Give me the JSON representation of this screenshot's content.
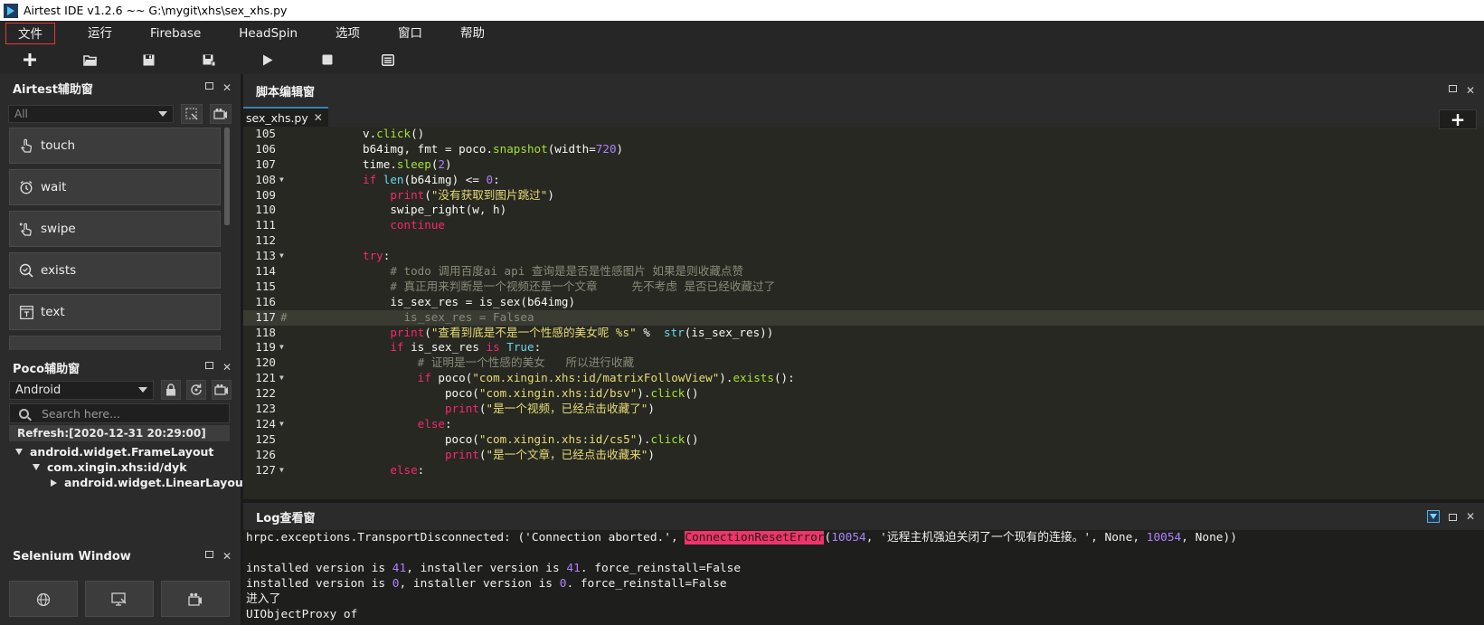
{
  "window": {
    "title": "Airtest IDE v1.2.6 ~~ G:\\mygit\\xhs\\sex_xhs.py"
  },
  "menu": [
    "文件",
    "运行",
    "Firebase",
    "HeadSpin",
    "选项",
    "窗口",
    "帮助"
  ],
  "toolbar": [
    "new-icon",
    "open-icon",
    "save-icon",
    "save-as-icon",
    "run-icon",
    "stop-icon",
    "log-icon"
  ],
  "airtest_panel": {
    "title": "Airtest辅助窗",
    "filter_placeholder": "All",
    "items": [
      {
        "label": "touch",
        "icon": "touch-icon"
      },
      {
        "label": "wait",
        "icon": "alarm-icon"
      },
      {
        "label": "swipe",
        "icon": "swipe-icon"
      },
      {
        "label": "exists",
        "icon": "search-icon"
      },
      {
        "label": "text",
        "icon": "text-icon"
      }
    ]
  },
  "poco_panel": {
    "title": "Poco辅助窗",
    "platform": "Android",
    "search_placeholder": "Search here...",
    "refresh": "Refresh:[2020-12-31 20:29:00]",
    "tree": [
      {
        "label": "android.widget.FrameLayout",
        "depth": 0,
        "expanded": true
      },
      {
        "label": "com.xingin.xhs:id/dyk",
        "depth": 1,
        "expanded": true
      },
      {
        "label": "android.widget.LinearLayout",
        "depth": 2,
        "expanded": false
      }
    ]
  },
  "selenium_panel": {
    "title": "Selenium Window"
  },
  "editor": {
    "title": "脚本编辑窗",
    "tab": "sex_xhs.py",
    "highlighted_line": 117,
    "lines": [
      {
        "n": "105",
        "fold": false,
        "code": [
          [
            "",
            "            v."
          ],
          [
            "fn",
            "click"
          ],
          [
            "",
            "()"
          ]
        ]
      },
      {
        "n": "106",
        "fold": false,
        "code": [
          [
            "",
            "            b64img, fmt = poco."
          ],
          [
            "fn",
            "snapshot"
          ],
          [
            "",
            "(width="
          ],
          [
            "num",
            "720"
          ],
          [
            "",
            ")"
          ]
        ]
      },
      {
        "n": "107",
        "fold": false,
        "code": [
          [
            "",
            "            time."
          ],
          [
            "fn",
            "sleep"
          ],
          [
            "",
            "("
          ],
          [
            "num",
            "2"
          ],
          [
            "",
            ")"
          ]
        ]
      },
      {
        "n": "108",
        "fold": true,
        "code": [
          [
            "",
            "            "
          ],
          [
            "kw",
            "if"
          ],
          [
            "",
            " "
          ],
          [
            "bi",
            "len"
          ],
          [
            "",
            "(b64img) <= "
          ],
          [
            "num",
            "0"
          ],
          [
            "",
            ":"
          ]
        ]
      },
      {
        "n": "109",
        "fold": false,
        "code": [
          [
            "",
            "                "
          ],
          [
            "kw",
            "print"
          ],
          [
            "",
            "("
          ],
          [
            "str",
            "\"没有获取到图片跳过\""
          ],
          [
            "",
            ")"
          ]
        ]
      },
      {
        "n": "110",
        "fold": false,
        "code": [
          [
            "",
            "                swipe_right(w, h)"
          ]
        ]
      },
      {
        "n": "111",
        "fold": false,
        "code": [
          [
            "",
            "                "
          ],
          [
            "kw",
            "continue"
          ]
        ]
      },
      {
        "n": "112",
        "fold": false,
        "code": [
          [
            "",
            ""
          ]
        ]
      },
      {
        "n": "113",
        "fold": true,
        "code": [
          [
            "",
            "            "
          ],
          [
            "kw",
            "try"
          ],
          [
            "",
            ":"
          ]
        ]
      },
      {
        "n": "114",
        "fold": false,
        "code": [
          [
            "",
            "                "
          ],
          [
            "cm",
            "# todo 调用百度ai api 查询是是否是性感图片 如果是则收藏点赞"
          ]
        ]
      },
      {
        "n": "115",
        "fold": false,
        "code": [
          [
            "",
            "                "
          ],
          [
            "cm",
            "# 真正用来判断是一个视频还是一个文章     先不考虑 是否已经收藏过了"
          ]
        ]
      },
      {
        "n": "116",
        "fold": false,
        "code": [
          [
            "",
            "                is_sex_res = is_sex(b64img)"
          ]
        ]
      },
      {
        "n": "117",
        "fold": false,
        "code": [
          [
            "cm",
            "#                 is_sex_res = Falsea"
          ]
        ]
      },
      {
        "n": "118",
        "fold": false,
        "code": [
          [
            "",
            "                "
          ],
          [
            "kw",
            "print"
          ],
          [
            "",
            "("
          ],
          [
            "str",
            "\"查看到底是不是一个性感的美女呢 %s\""
          ],
          [
            "",
            " %  "
          ],
          [
            "bi",
            "str"
          ],
          [
            "",
            "(is_sex_res))"
          ]
        ]
      },
      {
        "n": "119",
        "fold": true,
        "code": [
          [
            "",
            "                "
          ],
          [
            "kw",
            "if"
          ],
          [
            "",
            " is_sex_res "
          ],
          [
            "kw",
            "is"
          ],
          [
            "",
            " "
          ],
          [
            "bi",
            "True"
          ],
          [
            "",
            ":"
          ]
        ]
      },
      {
        "n": "120",
        "fold": false,
        "code": [
          [
            "",
            "                    "
          ],
          [
            "cm",
            "# 证明是一个性感的美女   所以进行收藏"
          ]
        ]
      },
      {
        "n": "121",
        "fold": true,
        "code": [
          [
            "",
            "                    "
          ],
          [
            "kw",
            "if"
          ],
          [
            "",
            " poco("
          ],
          [
            "str",
            "\"com.xingin.xhs:id/matrixFollowView\""
          ],
          [
            "",
            ")."
          ],
          [
            "fn",
            "exists"
          ],
          [
            "",
            "():"
          ]
        ]
      },
      {
        "n": "122",
        "fold": false,
        "code": [
          [
            "",
            "                        poco("
          ],
          [
            "str",
            "\"com.xingin.xhs:id/bsv\""
          ],
          [
            "",
            ")."
          ],
          [
            "fn",
            "click"
          ],
          [
            "",
            "()"
          ]
        ]
      },
      {
        "n": "123",
        "fold": false,
        "code": [
          [
            "",
            "                        "
          ],
          [
            "kw",
            "print"
          ],
          [
            "",
            "("
          ],
          [
            "str",
            "\"是一个视频，已经点击收藏了\""
          ],
          [
            "",
            ")"
          ]
        ]
      },
      {
        "n": "124",
        "fold": true,
        "code": [
          [
            "",
            "                    "
          ],
          [
            "kw",
            "else"
          ],
          [
            "",
            ":"
          ]
        ]
      },
      {
        "n": "125",
        "fold": false,
        "code": [
          [
            "",
            "                        poco("
          ],
          [
            "str",
            "\"com.xingin.xhs:id/cs5\""
          ],
          [
            "",
            ")."
          ],
          [
            "fn",
            "click"
          ],
          [
            "",
            "()"
          ]
        ]
      },
      {
        "n": "126",
        "fold": false,
        "code": [
          [
            "",
            "                        "
          ],
          [
            "kw",
            "print"
          ],
          [
            "",
            "("
          ],
          [
            "str",
            "\"是一个文章，已经点击收藏来\""
          ],
          [
            "",
            ")"
          ]
        ]
      },
      {
        "n": "127",
        "fold": true,
        "code": [
          [
            "",
            "                "
          ],
          [
            "kw",
            "else"
          ],
          [
            "",
            ":"
          ]
        ]
      }
    ]
  },
  "log": {
    "title": "Log查看窗",
    "lines": [
      [
        [
          "",
          "hrpc.exceptions.TransportDisconnected: ('Connection aborted.', "
        ],
        [
          "err",
          "ConnectionResetError"
        ],
        [
          "",
          "("
        ],
        [
          "num",
          "10054"
        ],
        [
          "",
          ", '远程主机强迫关闭了一个现有的连接。', None, "
        ],
        [
          "num",
          "10054"
        ],
        [
          "",
          ", None))"
        ]
      ],
      [
        [
          "",
          ""
        ]
      ],
      [
        [
          "",
          "installed version is "
        ],
        [
          "num",
          "41"
        ],
        [
          "",
          ", installer version is "
        ],
        [
          "num",
          "41"
        ],
        [
          "",
          ". force_reinstall=False"
        ]
      ],
      [
        [
          "",
          "installed version is "
        ],
        [
          "num",
          "0"
        ],
        [
          "",
          ", installer version is "
        ],
        [
          "num",
          "0"
        ],
        [
          "",
          ". force_reinstall=False"
        ]
      ],
      [
        [
          "",
          "进入了"
        ]
      ],
      [
        [
          "",
          "UIObjectProxy of"
        ]
      ]
    ]
  }
}
